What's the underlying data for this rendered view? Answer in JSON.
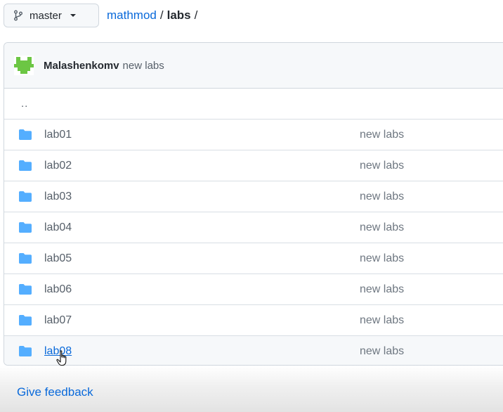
{
  "branch": {
    "label": "master",
    "icon": "git-branch-icon"
  },
  "breadcrumb": {
    "repo": "mathmod",
    "separator": "/",
    "dir": "labs",
    "trailing": "/"
  },
  "latest_commit": {
    "author": "Malashenkomv",
    "message": "new labs",
    "avatar_icon": "identicon-avatar"
  },
  "files": {
    "parent": "..",
    "items": [
      {
        "name": "lab01",
        "message": "new labs",
        "icon": "folder-icon"
      },
      {
        "name": "lab02",
        "message": "new labs",
        "icon": "folder-icon"
      },
      {
        "name": "lab03",
        "message": "new labs",
        "icon": "folder-icon"
      },
      {
        "name": "lab04",
        "message": "new labs",
        "icon": "folder-icon"
      },
      {
        "name": "lab05",
        "message": "new labs",
        "icon": "folder-icon"
      },
      {
        "name": "lab06",
        "message": "new labs",
        "icon": "folder-icon"
      },
      {
        "name": "lab07",
        "message": "new labs",
        "icon": "folder-icon"
      },
      {
        "name": "lab08",
        "message": "new labs",
        "icon": "folder-icon"
      }
    ]
  },
  "footer": {
    "feedback_label": "Give feedback"
  },
  "colors": {
    "link": "#0969da",
    "folder": "#54aeff",
    "avatar": "#6cc644"
  }
}
